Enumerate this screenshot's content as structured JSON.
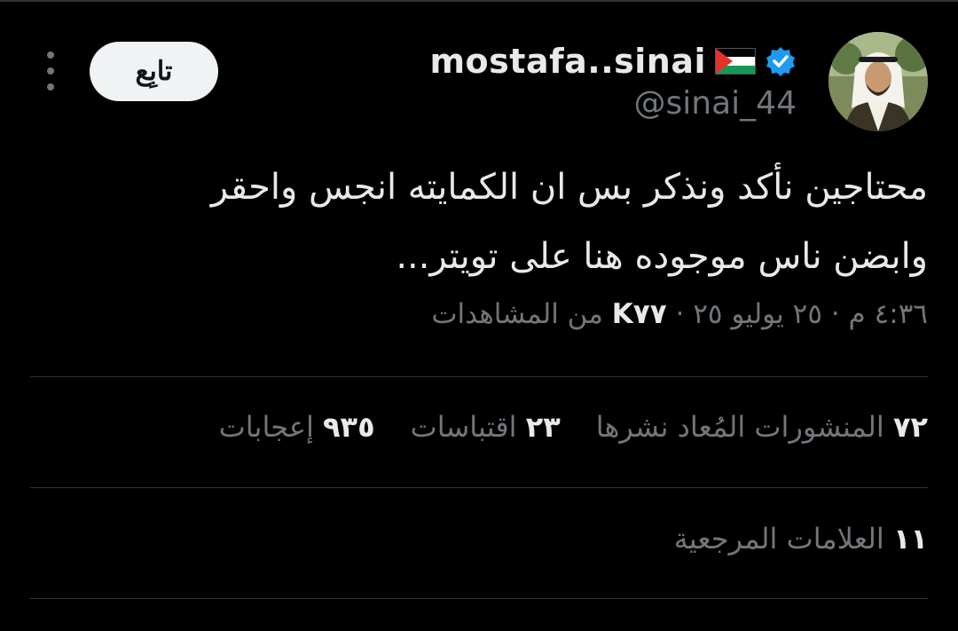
{
  "author": {
    "display_name": "mostafa..sinai",
    "handle": "@sinai_44",
    "flag_icon": "palestine-flag-icon",
    "verified_icon": "verified-badge-icon",
    "verified_color": "#1d9bf0"
  },
  "follow_button": {
    "label": "تابِع"
  },
  "more_icon": "more-options-icon",
  "tweet": {
    "text_line1": "محتاجين نأكد ونذكر بس ان الكمايته انجس واحقر",
    "text_line2": "وابضن ناس موجوده هنا على تويتر..."
  },
  "meta": {
    "timestamp": "٤:٣٦ م · ٢٥ يوليو ٢٥",
    "separator": " · ",
    "views_count": "K٧٧",
    "views_label": "من المشاهدات"
  },
  "stats": {
    "reposts_count": "٧٢",
    "reposts_label": "المنشورات المُعاد نشرها",
    "quotes_count": "٢٣",
    "quotes_label": "اقتباسات",
    "likes_count": "٩٣٥",
    "likes_label": "إعجابات"
  },
  "bookmarks": {
    "count": "١١",
    "label": "العلامات المرجعية"
  },
  "colors": {
    "background": "#000000",
    "text_primary": "#e7e9ea",
    "text_secondary": "#71767b",
    "divider": "#2f3336",
    "button_bg": "#eff3f4"
  }
}
